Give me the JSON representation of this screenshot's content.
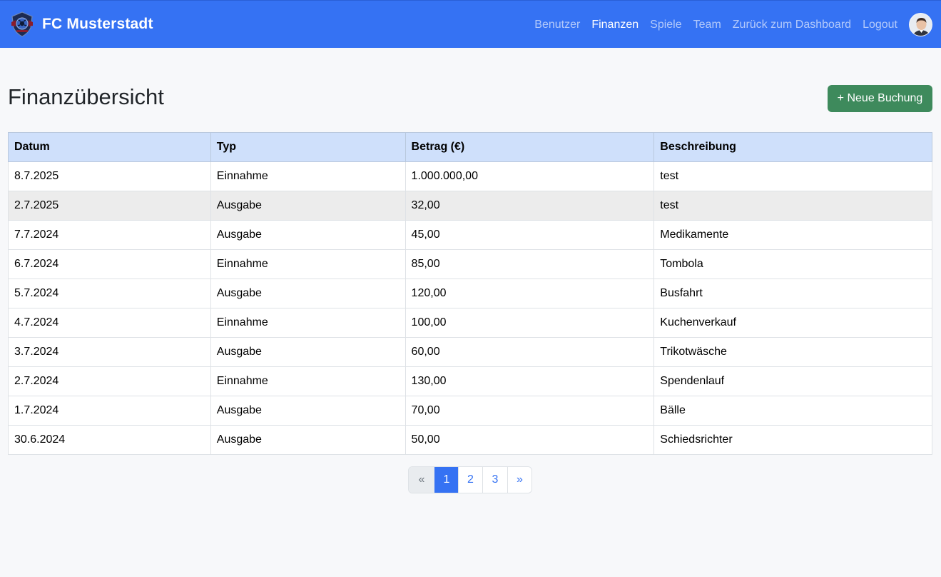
{
  "app": {
    "brand_name": "FC Musterstadt",
    "logo_icon": "club-crest-icon",
    "colors": {
      "navbar": "#3572f3",
      "primary": "#3572f3",
      "success": "#3e8a5c",
      "table_header": "#cfe0fb"
    }
  },
  "nav": {
    "items": [
      {
        "label": "Benutzer",
        "active": false
      },
      {
        "label": "Finanzen",
        "active": true
      },
      {
        "label": "Spiele",
        "active": false
      },
      {
        "label": "Team",
        "active": false
      },
      {
        "label": "Zurück zum Dashboard",
        "active": false
      },
      {
        "label": "Logout",
        "active": false
      }
    ],
    "avatar_icon": "user-avatar-icon"
  },
  "page": {
    "title": "Finanzübersicht",
    "new_button_label": "+ Neue Buchung"
  },
  "table": {
    "headers": [
      "Datum",
      "Typ",
      "Betrag (€)",
      "Beschreibung"
    ],
    "rows": [
      [
        "8.7.2025",
        "Einnahme",
        "1.000.000,00",
        "test"
      ],
      [
        "2.7.2025",
        "Ausgabe",
        "32,00",
        "test"
      ],
      [
        "7.7.2024",
        "Ausgabe",
        "45,00",
        "Medikamente"
      ],
      [
        "6.7.2024",
        "Einnahme",
        "85,00",
        "Tombola"
      ],
      [
        "5.7.2024",
        "Ausgabe",
        "120,00",
        "Busfahrt"
      ],
      [
        "4.7.2024",
        "Einnahme",
        "100,00",
        "Kuchenverkauf"
      ],
      [
        "3.7.2024",
        "Ausgabe",
        "60,00",
        "Trikotwäsche"
      ],
      [
        "2.7.2024",
        "Einnahme",
        "130,00",
        "Spendenlauf"
      ],
      [
        "1.7.2024",
        "Ausgabe",
        "70,00",
        "Bälle"
      ],
      [
        "30.6.2024",
        "Ausgabe",
        "50,00",
        "Schiedsrichter"
      ]
    ],
    "highlighted_row": 2
  },
  "pagination": {
    "prev_label": "«",
    "pages": [
      "1",
      "2",
      "3"
    ],
    "current_page": "1",
    "next_label": "»"
  }
}
